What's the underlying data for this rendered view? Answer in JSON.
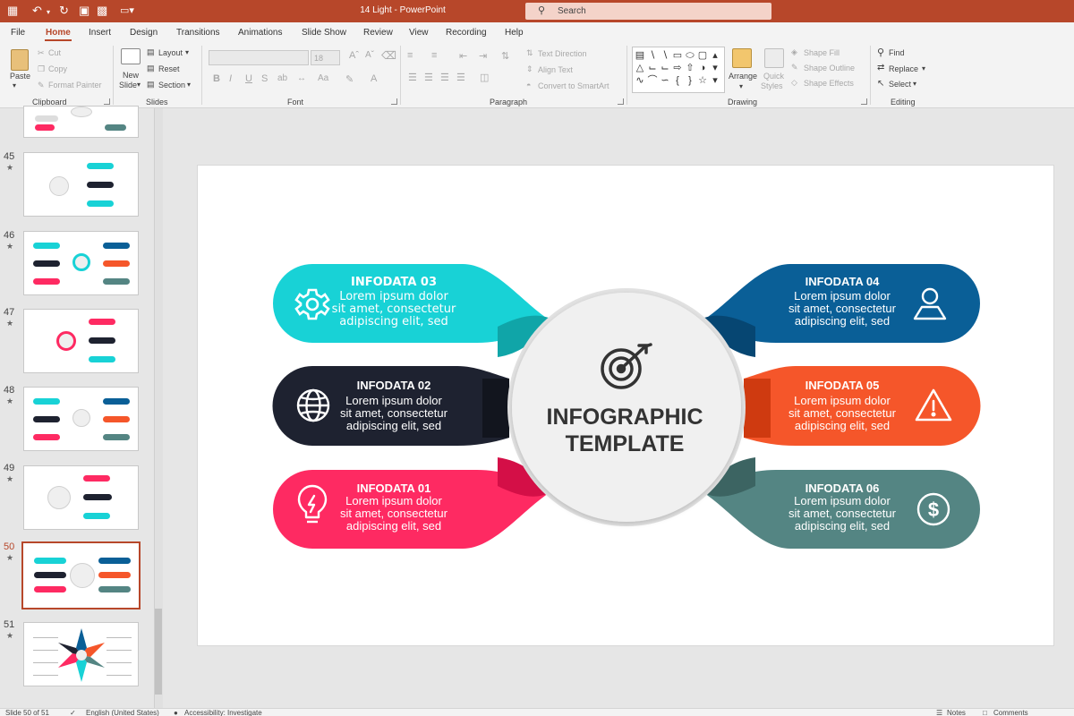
{
  "app": {
    "title": "14 Light  -  PowerPoint",
    "search_placeholder": "Search"
  },
  "tabs": [
    "File",
    "Home",
    "Insert",
    "Design",
    "Transitions",
    "Animations",
    "Slide Show",
    "Review",
    "View",
    "Recording",
    "Help"
  ],
  "ribbon": {
    "clipboard": {
      "paste": "Paste",
      "cut": "Cut",
      "copy": "Copy",
      "format_painter": "Format Painter",
      "label": "Clipboard"
    },
    "slides": {
      "new_slide_1": "New",
      "new_slide_2": "Slide",
      "layout": "Layout",
      "reset": "Reset",
      "section": "Section",
      "label": "Slides"
    },
    "font": {
      "size": "18",
      "bold": "B",
      "italic": "I",
      "underline": "U",
      "strike": "S",
      "label": "Font"
    },
    "paragraph": {
      "text_direction": "Text Direction",
      "align_text": "Align Text",
      "smartart": "Convert to SmartArt",
      "label": "Paragraph"
    },
    "drawing": {
      "arrange": "Arrange",
      "quick_styles_1": "Quick",
      "quick_styles_2": "Styles",
      "shape_fill": "Shape Fill",
      "shape_outline": "Shape Outline",
      "shape_effects": "Shape Effects",
      "label": "Drawing"
    },
    "editing": {
      "find": "Find",
      "replace": "Replace",
      "select": "Select",
      "label": "Editing"
    }
  },
  "slide_panel": {
    "numbers": [
      "45",
      "46",
      "47",
      "48",
      "49",
      "50",
      "51"
    ],
    "active": "50"
  },
  "slide": {
    "center_title_1": "INFOGRAPHIC",
    "center_title_2": "TEMPLATE",
    "items": [
      {
        "title": "INFODATA 03",
        "l1": "Lorem ipsum dolor",
        "l2": "sit amet, consectetur",
        "l3": "adipiscing elit, sed",
        "color": "#18d2d6",
        "dark": "#10a5a8",
        "icon": "gear-icon"
      },
      {
        "title": "INFODATA 02",
        "l1": "Lorem ipsum dolor",
        "l2": "sit amet, consectetur",
        "l3": "adipiscing elit, sed",
        "color": "#1e2230",
        "dark": "#12151e",
        "icon": "globe-icon"
      },
      {
        "title": "INFODATA 01",
        "l1": "Lorem ipsum dolor",
        "l2": "sit amet, consectetur",
        "l3": "adipiscing elit, sed",
        "color": "#fe2a62",
        "dark": "#d40f47",
        "icon": "lightbulb-icon"
      },
      {
        "title": "INFODATA 04",
        "l1": "Lorem ipsum dolor",
        "l2": "sit amet, consectetur",
        "l3": "adipiscing elit, sed",
        "color": "#0a5f97",
        "dark": "#064672",
        "icon": "user-icon"
      },
      {
        "title": "INFODATA 05",
        "l1": "Lorem ipsum dolor",
        "l2": "sit amet, consectetur",
        "l3": "adipiscing elit, sed",
        "color": "#f5562a",
        "dark": "#cf3a10",
        "icon": "warning-icon"
      },
      {
        "title": "INFODATA 06",
        "l1": "Lorem ipsum dolor",
        "l2": "sit amet, consectetur",
        "l3": "adipiscing elit, sed",
        "color": "#548583",
        "dark": "#3c6462",
        "icon": "dollar-icon"
      }
    ]
  },
  "status": {
    "slide_info": "Slide 50 of 51",
    "language": "English (United States)",
    "accessibility": "Accessibility: Investigate",
    "notes": "Notes",
    "comments": "Comments"
  }
}
